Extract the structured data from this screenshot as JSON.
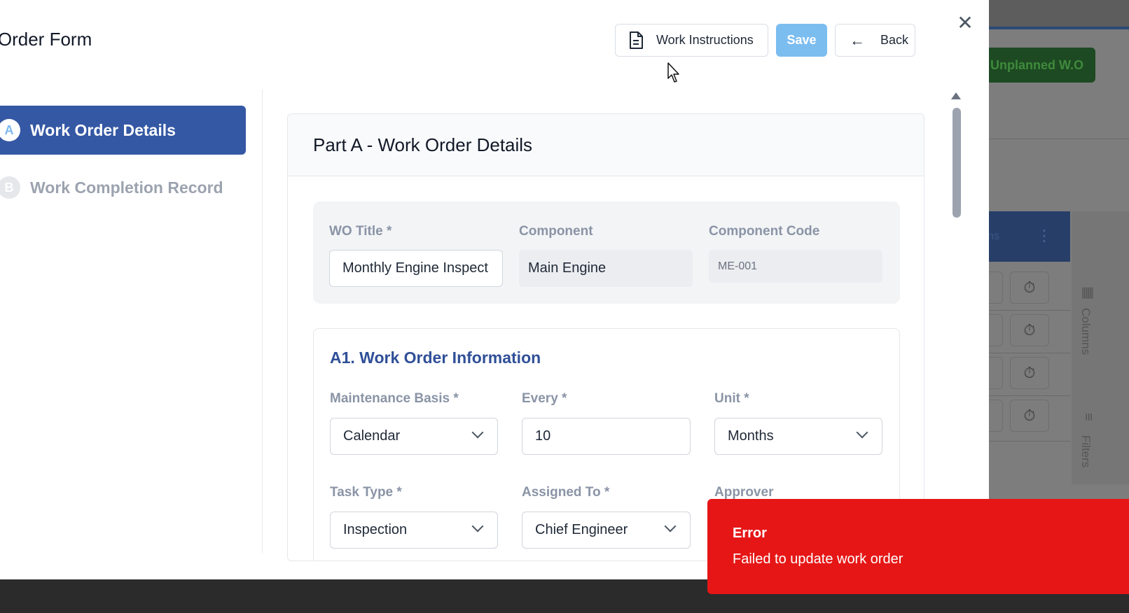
{
  "modal": {
    "title": "rk Order Form",
    "buttons": {
      "work_instructions": "Work Instructions",
      "save": "Save",
      "back": "Back"
    }
  },
  "steps": [
    {
      "badge": "A",
      "label": "Work Order Details",
      "active": true
    },
    {
      "badge": "B",
      "label": "Work Completion Record",
      "active": false
    }
  ],
  "part_a": {
    "title": "Part A - Work Order Details",
    "wo_title": {
      "label": "WO Title *",
      "value": "Monthly Engine Inspect"
    },
    "component": {
      "label": "Component",
      "value": "Main Engine"
    },
    "component_code": {
      "label": "Component Code",
      "value": "ME-001"
    },
    "a1": {
      "title": "A1. Work Order Information",
      "maintenance_basis": {
        "label": "Maintenance Basis *",
        "value": "Calendar"
      },
      "every": {
        "label": "Every *",
        "value": "10"
      },
      "unit": {
        "label": "Unit *",
        "value": "Months"
      },
      "task_type": {
        "label": "Task Type *",
        "value": "Inspection"
      },
      "assigned_to": {
        "label": "Assigned To *",
        "value": "Chief Engineer"
      },
      "approver": {
        "label": "Approver"
      }
    }
  },
  "background": {
    "unplanned_button": "Unplanned W.O",
    "header_fragment": "ns",
    "columns_label": "Columns",
    "filters_label": "Filters"
  },
  "toast": {
    "title": "Error",
    "message": "Failed to update work order",
    "color": "#e61616"
  },
  "colors": {
    "accent": "#3558a4",
    "save_button": "#7cbdf0",
    "section_title": "#2f4f97"
  }
}
